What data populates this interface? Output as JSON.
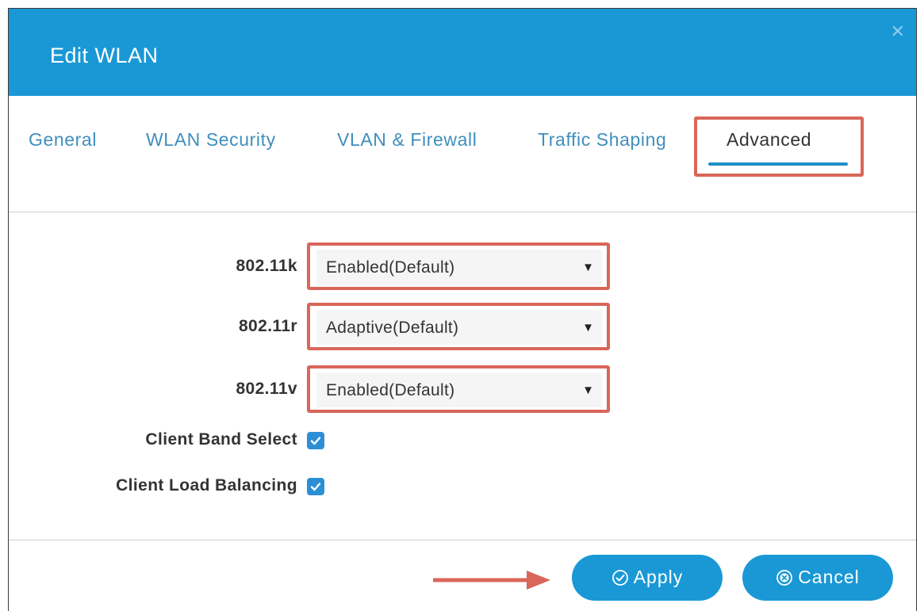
{
  "dialog": {
    "title": "Edit WLAN",
    "close_icon": "close-icon"
  },
  "tabs": [
    {
      "label": "General",
      "active": false
    },
    {
      "label": "WLAN Security",
      "active": false
    },
    {
      "label": "VLAN & Firewall",
      "active": false
    },
    {
      "label": "Traffic Shaping",
      "active": false
    },
    {
      "label": "Advanced",
      "active": true
    }
  ],
  "fields": {
    "k": {
      "label": "802.11k",
      "value": "Enabled(Default)"
    },
    "r": {
      "label": "802.11r",
      "value": "Adaptive(Default)"
    },
    "v": {
      "label": "802.11v",
      "value": "Enabled(Default)"
    },
    "band_select": {
      "label": "Client Band Select",
      "checked": true
    },
    "load_balancing": {
      "label": "Client Load Balancing",
      "checked": true
    }
  },
  "buttons": {
    "apply": {
      "label": "Apply",
      "icon": "check-circle-icon"
    },
    "cancel": {
      "label": "Cancel",
      "icon": "x-circle-icon"
    }
  },
  "colors": {
    "header": "#1a98d5",
    "highlight": "#d9665a",
    "tab_link": "#3f8fbc",
    "checkbox": "#2c8fd6"
  }
}
